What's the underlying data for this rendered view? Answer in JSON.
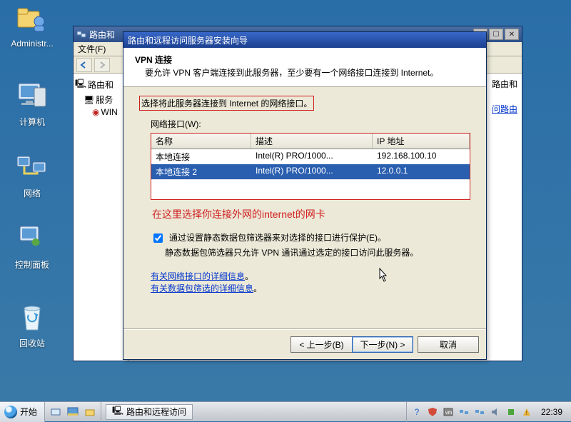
{
  "desktop_icons": {
    "admin": {
      "label": "Administr..."
    },
    "computer": {
      "label": "计算机"
    },
    "network": {
      "label": "网络"
    },
    "control": {
      "label": "控制面板"
    },
    "recycle": {
      "label": "回收站"
    }
  },
  "parent_window": {
    "title": "路由和",
    "menu_file": "文件(F)",
    "tree": {
      "root": "路由和",
      "srv": "服务",
      "win": "WIN"
    },
    "content": {
      "heading": "路由和",
      "link": "问路由"
    }
  },
  "wizard": {
    "title": "路由和远程访问服务器安装向导",
    "header_h1": "VPN 连接",
    "header_h2": "要允许 VPN 客户端连接到此服务器，至少要有一个网络接口连接到 Internet。",
    "instruction": "选择将此服务器连接到 Internet 的网络接口。",
    "iface_label": "网络接口(W):",
    "table": {
      "col_name": "名称",
      "col_desc": "描述",
      "col_ip": "IP 地址",
      "rows": [
        {
          "name": "本地连接",
          "desc": "Intel(R) PRO/1000...",
          "ip": "192.168.100.10",
          "selected": false
        },
        {
          "name": "本地连接 2",
          "desc": "Intel(R) PRO/1000...",
          "ip": "12.0.0.1",
          "selected": true
        }
      ]
    },
    "annotation": "在这里选择你连接外网的internet的网卡",
    "checkbox_label": "通过设置静态数据包筛选器来对选择的接口进行保护(E)。",
    "checkbox_note": "静态数据包筛选器只允许 VPN 通讯通过选定的接口访问此服务器。",
    "link_iface": "有关网络接口的详细信息",
    "link_filter": "有关数据包筛选的详细信息",
    "btn_back": "< 上一步(B)",
    "btn_next": "下一步(N) >",
    "btn_cancel": "取消"
  },
  "taskbar": {
    "start": "开始",
    "task_item": "路由和远程访问",
    "clock": "22:39"
  }
}
